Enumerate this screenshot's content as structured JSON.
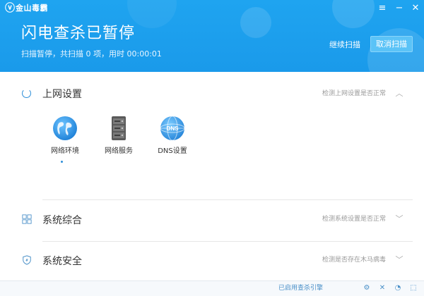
{
  "app": {
    "logo_text": "金山毒霸"
  },
  "titlebar": {
    "menu_icon": "menu-icon",
    "minimize_icon": "minimize-icon",
    "close_icon": "close-icon"
  },
  "status": {
    "title": "闪电查杀已暂停",
    "subtitle": "扫描暂停，共扫描 0 项，用时 00:00:01"
  },
  "actions": {
    "continue_label": "继续扫描",
    "cancel_label": "取消扫描"
  },
  "sections": [
    {
      "title": "上网设置",
      "desc": "检测上网设置是否正常",
      "state": "scanning",
      "tiles": [
        {
          "label": "网络环境",
          "icon": "globe-icon"
        },
        {
          "label": "网络服务",
          "icon": "server-icon"
        },
        {
          "label": "DNS设置",
          "icon": "dns-globe-icon"
        }
      ]
    },
    {
      "title": "系统综合",
      "desc": "检测系统设置是否正常",
      "icon": "windows-icon"
    },
    {
      "title": "系统安全",
      "desc": "检测是否存在木马病毒",
      "icon": "shield-icon"
    }
  ],
  "footer": {
    "text": "已启用查杀引擎"
  },
  "colors": {
    "header_blue": "#1fa4f0",
    "accent_blue": "#2d8ed8",
    "cancel_button": "#5bc3f7"
  }
}
